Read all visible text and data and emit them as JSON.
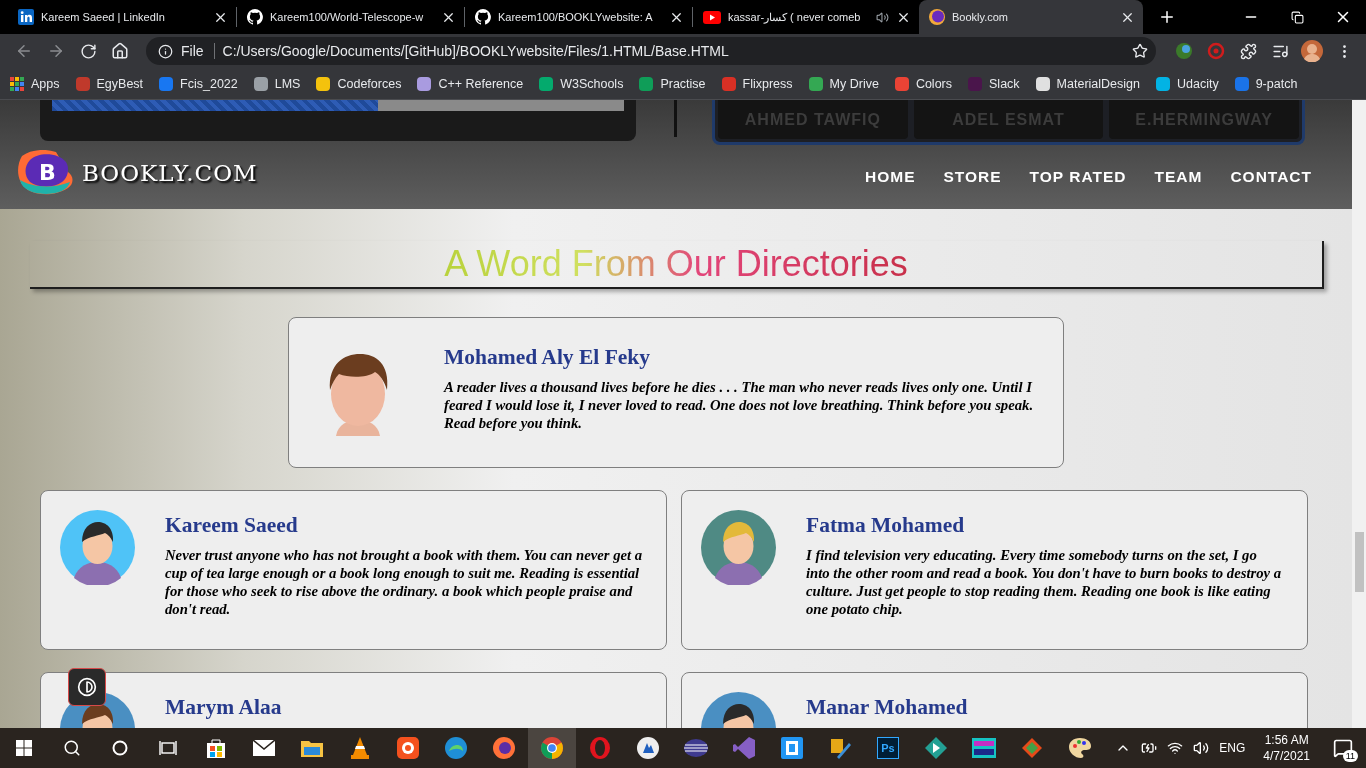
{
  "browser": {
    "tabs": [
      {
        "title": "Kareem Saeed | LinkedIn",
        "kind": "square",
        "selected": false,
        "audio": false
      },
      {
        "title": "Kareem100/World-Telescope-w",
        "kind": "cat",
        "selected": false,
        "audio": false
      },
      {
        "title": "Kareem100/BOOKLYwebsite: A",
        "kind": "cat",
        "selected": false,
        "audio": false
      },
      {
        "title": "kassar-كسار ( never comeb",
        "kind": "play",
        "selected": false,
        "audio": true
      },
      {
        "title": "Bookly.com",
        "kind": "badge",
        "selected": true,
        "audio": false
      }
    ],
    "address": {
      "scheme": "File",
      "url": "C:/Users/Google/Documents/[GitHub]/BOOKLYwebsite/Files/1.HTML/Base.HTML"
    },
    "bookmarks": [
      {
        "label": "Apps",
        "kind": "apps",
        "color": "#e8453c"
      },
      {
        "label": "EgyBest",
        "kind": "site",
        "color": "#c0392b"
      },
      {
        "label": "Fcis_2022",
        "kind": "site",
        "color": "#1877f2"
      },
      {
        "label": "LMS",
        "kind": "site",
        "color": "#9aa0a6"
      },
      {
        "label": "Codeforces",
        "kind": "site",
        "color": "#f4c20d"
      },
      {
        "label": "C++ Reference",
        "kind": "site",
        "color": "#a99be0"
      },
      {
        "label": "W3Schools",
        "kind": "site",
        "color": "#04aa6d"
      },
      {
        "label": "Practise",
        "kind": "site",
        "color": "#0f9d58"
      },
      {
        "label": "Flixpress",
        "kind": "site",
        "color": "#d93025"
      },
      {
        "label": "My Drive",
        "kind": "site",
        "color": "#34a853"
      },
      {
        "label": "Colors",
        "kind": "site",
        "color": "#ea4335"
      },
      {
        "label": "Slack",
        "kind": "site",
        "color": "#4a154b"
      },
      {
        "label": "MaterialDesign",
        "kind": "site",
        "color": "#e0e0e0"
      },
      {
        "label": "Udacity",
        "kind": "site",
        "color": "#02b3e4"
      },
      {
        "label": "9-patch",
        "kind": "site",
        "color": "#1a73e8"
      }
    ]
  },
  "page": {
    "progress": {
      "level": 0.57
    },
    "team": [
      "AHMED TAWFIQ",
      "ADEL ESMAT",
      "E.HERMINGWAY"
    ],
    "logo": {
      "letter": "B",
      "text": "BOOKLY.COM"
    },
    "nav": [
      {
        "label": "HOME"
      },
      {
        "label": "STORE"
      },
      {
        "label": "TOP RATED"
      },
      {
        "label": "TEAM"
      },
      {
        "label": "CONTACT"
      }
    ],
    "heading": "A Word From Our Directories",
    "featured": {
      "name": "Mohamed Aly El Feky",
      "quote": "A reader lives a thousand lives before he dies . . . The man who never reads lives only one. Until I feared I would lose it, I never loved to read. One does not love breathing. Think before you speak. Read before you think."
    },
    "testimonials": [
      {
        "name": "Kareem Saeed",
        "quote": "Never trust anyone who has not brought a book with them. You can never get a cup of tea large enough or a book long enough to suit me. Reading is essential for those who seek to rise above the ordinary. a book which people praise and don't read."
      },
      {
        "name": "Fatma Mohamed",
        "quote": "I find television very educating. Every time somebody turns on the set, I go into the other room and read a book. You don't have to burn books to destroy a culture. Just get people to stop reading them. Reading one book is like eating one potato chip."
      },
      {
        "name": "Marym Alaa"
      },
      {
        "name": "Manar Mohamed"
      }
    ]
  },
  "taskbar": {
    "apps": [
      {
        "selected": false
      },
      {
        "selected": false
      },
      {
        "selected": false
      },
      {
        "selected": false
      },
      {
        "selected": false
      },
      {
        "selected": false
      },
      {
        "selected": false
      },
      {
        "selected": false
      },
      {
        "selected": false
      },
      {
        "selected": false
      },
      {
        "selected": false
      },
      {
        "selected": true
      },
      {
        "selected": false
      },
      {
        "selected": false
      },
      {
        "selected": false
      },
      {
        "selected": false
      },
      {
        "selected": false
      },
      {
        "selected": false
      },
      {
        "selected": false,
        "label": "Ps"
      },
      {
        "selected": false
      },
      {
        "selected": false
      },
      {
        "selected": false
      },
      {
        "selected": false
      }
    ],
    "language": "ENG",
    "time": "1:56 AM",
    "date": "4/7/2021",
    "notifications": "11"
  }
}
